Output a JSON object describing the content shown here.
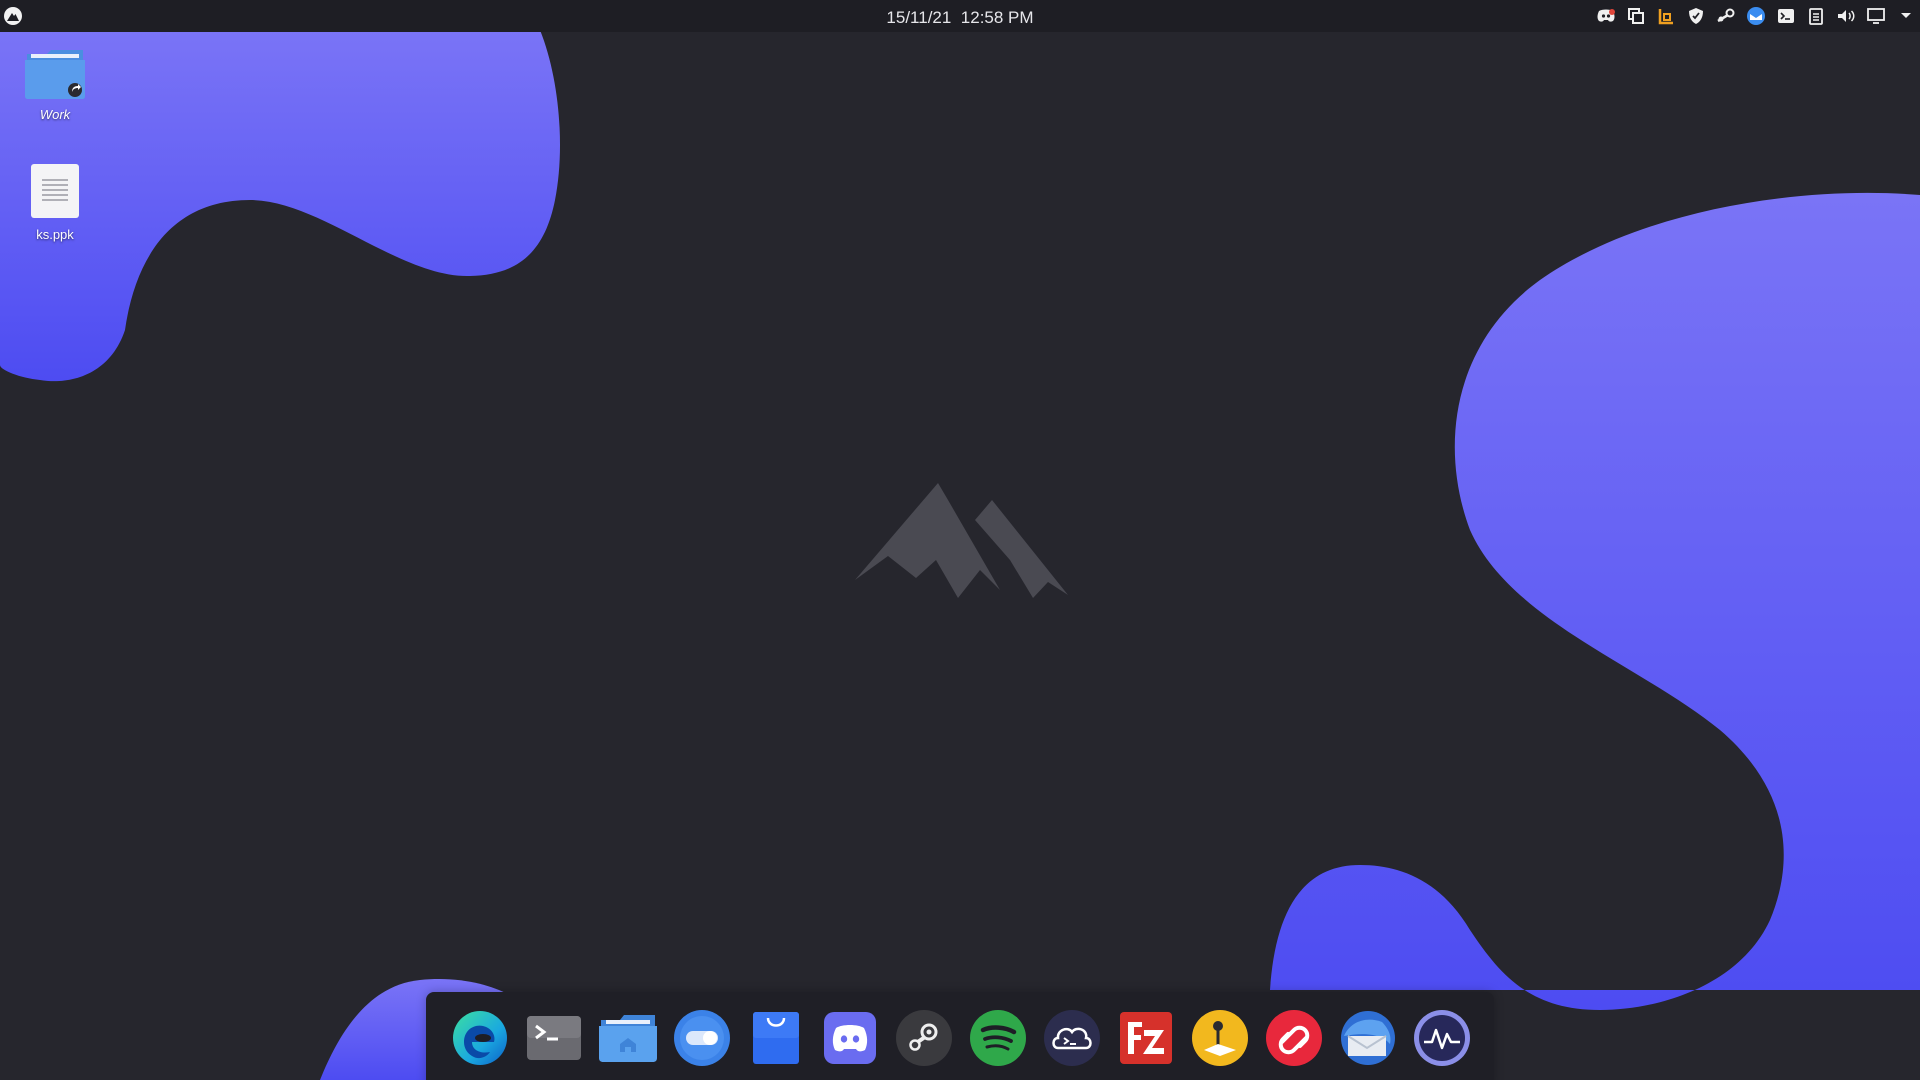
{
  "panel": {
    "clock_date": "15/11/21",
    "clock_time": "12:58 PM",
    "launcher_icon": "mountain-logo-icon",
    "tray_icons": [
      "discord-tray-icon",
      "clipboard-sync-icon",
      "blender-tray-icon",
      "shield-icon",
      "steam-tray-icon",
      "mail-tray-icon",
      "terminal-tray-icon",
      "clipboard-icon",
      "volume-icon",
      "display-icon",
      "chevron-down-icon"
    ]
  },
  "desktop_icons": [
    {
      "name": "Work",
      "icon": "folder-icon",
      "italic": true
    },
    {
      "name": "ks.ppk",
      "icon": "text-file-icon",
      "italic": false
    }
  ],
  "dock_items": [
    {
      "app": "Microsoft Edge",
      "icon": "edge-icon",
      "active": true
    },
    {
      "app": "Terminal",
      "icon": "terminal-icon"
    },
    {
      "app": "Files",
      "icon": "file-manager-icon"
    },
    {
      "app": "Settings",
      "icon": "toggle-icon"
    },
    {
      "app": "Store",
      "icon": "store-bag-icon"
    },
    {
      "app": "Discord",
      "icon": "discord-icon"
    },
    {
      "app": "Steam",
      "icon": "steam-icon"
    },
    {
      "app": "Spotify",
      "icon": "spotify-icon"
    },
    {
      "app": "Cloud Terminal",
      "icon": "cloud-terminal-icon"
    },
    {
      "app": "FileZilla",
      "icon": "filezilla-icon"
    },
    {
      "app": "Signal Tool",
      "icon": "joystick-icon"
    },
    {
      "app": "Authy",
      "icon": "authy-icon"
    },
    {
      "app": "Mail",
      "icon": "mail-icon"
    },
    {
      "app": "System Monitor",
      "icon": "system-monitor-icon"
    }
  ],
  "colors": {
    "background": "#26262d",
    "blob_top": "#7a74f6",
    "blob_bottom": "#4d4cf2",
    "panel": "#1e1e24",
    "dock": "#1f1f26",
    "logo": "#4a4a52"
  }
}
